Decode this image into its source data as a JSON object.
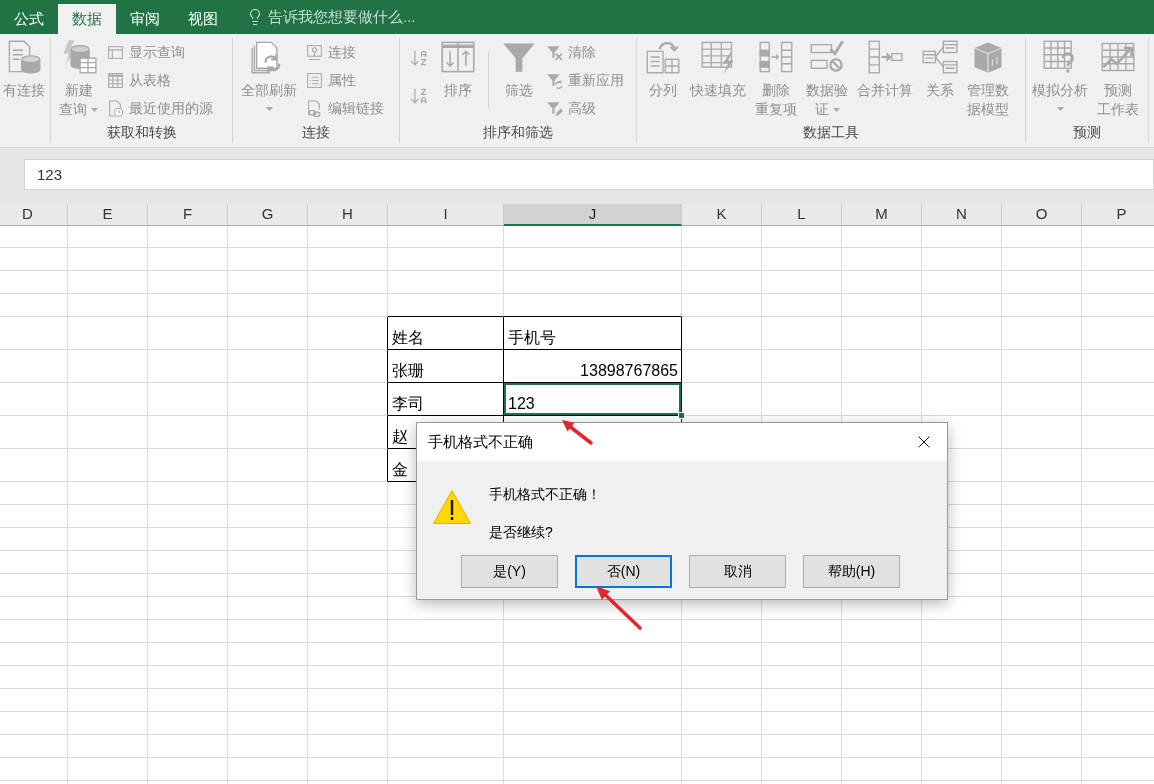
{
  "tabs": [
    {
      "label": "公式",
      "selected": false
    },
    {
      "label": "数据",
      "selected": true
    },
    {
      "label": "审阅",
      "selected": false
    },
    {
      "label": "视图",
      "selected": false
    }
  ],
  "tell_me": {
    "placeholder": "告诉我您想要做什么..."
  },
  "ribbon": {
    "disabled": true,
    "groups": [
      {
        "columns": [
          {
            "kind": "large",
            "label": "有连接",
            "dropdown": false
          }
        ]
      },
      {
        "label": "获取和转换",
        "columns": [
          {
            "kind": "large",
            "lines": [
              "新建",
              "查询"
            ],
            "dropdown": true
          },
          {
            "kind": "stack",
            "items": [
              {
                "label": "显示查询"
              },
              {
                "label": "从表格"
              },
              {
                "label": "最近使用的源"
              }
            ]
          }
        ]
      },
      {
        "label": "连接",
        "columns": [
          {
            "kind": "large",
            "label": "全部刷新",
            "dropdown": true
          },
          {
            "kind": "stack",
            "items": [
              {
                "label": "连接"
              },
              {
                "label": "属性"
              },
              {
                "label": "编辑链接"
              }
            ]
          }
        ]
      },
      {
        "label": "排序和筛选",
        "columns": [
          {
            "kind": "icon_stack"
          },
          {
            "kind": "large",
            "label": "排序",
            "dropdown": false
          },
          {
            "kind": "divider"
          },
          {
            "kind": "large",
            "label": "筛选",
            "dropdown": false
          },
          {
            "kind": "stack",
            "items": [
              {
                "label": "清除"
              },
              {
                "label": "重新应用"
              },
              {
                "label": "高级"
              }
            ]
          }
        ]
      },
      {
        "label": "数据工具",
        "columns": [
          {
            "kind": "large",
            "label": "分列",
            "dropdown": false
          },
          {
            "kind": "large",
            "label": "快速填充",
            "dropdown": false
          },
          {
            "kind": "large",
            "lines": [
              "删除",
              "重复项"
            ],
            "dropdown": false
          },
          {
            "kind": "large",
            "lines": [
              "数据验",
              "证"
            ],
            "dropdown": true
          },
          {
            "kind": "large",
            "label": "合并计算",
            "dropdown": false
          },
          {
            "kind": "large",
            "label": "关系",
            "dropdown": false
          },
          {
            "kind": "large",
            "lines": [
              "管理数",
              "据模型"
            ],
            "dropdown": false
          }
        ]
      },
      {
        "label": "预测",
        "columns": [
          {
            "kind": "large",
            "label": "模拟分析",
            "dropdown": true
          },
          {
            "kind": "large",
            "lines": [
              "预测",
              "工作表"
            ],
            "dropdown": false
          }
        ]
      }
    ]
  },
  "formula_bar": {
    "value": "123"
  },
  "sheet": {
    "columns": [
      {
        "label": "D",
        "selected": false
      },
      {
        "label": "E",
        "selected": false
      },
      {
        "label": "F",
        "selected": false
      },
      {
        "label": "G",
        "selected": false
      },
      {
        "label": "H",
        "selected": false
      },
      {
        "label": "I",
        "selected": false
      },
      {
        "label": "J",
        "selected": true
      },
      {
        "label": "K",
        "selected": false
      },
      {
        "label": "L",
        "selected": false
      },
      {
        "label": "M",
        "selected": false
      },
      {
        "label": "N",
        "selected": false
      },
      {
        "label": "O",
        "selected": false
      },
      {
        "label": "P",
        "selected": false
      }
    ],
    "table": {
      "rows": [
        [
          {
            "text": "姓名",
            "kind": "text",
            "selected": false
          },
          {
            "text": "手机号",
            "kind": "text",
            "selected": false
          }
        ],
        [
          {
            "text": "张珊",
            "kind": "text",
            "selected": false
          },
          {
            "text": "13898767865",
            "kind": "number",
            "selected": false
          }
        ],
        [
          {
            "text": "李司",
            "kind": "text",
            "selected": false
          },
          {
            "text": "123",
            "kind": "text",
            "selected": true
          }
        ],
        [
          {
            "text": "赵",
            "kind": "text",
            "selected": false
          }
        ],
        [
          {
            "text": "金",
            "kind": "text",
            "selected": false
          }
        ]
      ]
    }
  },
  "dialog": {
    "title": "手机格式不正确",
    "message": "手机格式不正确！",
    "question": "是否继续?",
    "buttons": [
      {
        "label": "是(Y)",
        "focused": false
      },
      {
        "label": "否(N)",
        "focused": true
      },
      {
        "label": "取消",
        "focused": false
      },
      {
        "label": "帮助(H)",
        "focused": false
      }
    ]
  }
}
